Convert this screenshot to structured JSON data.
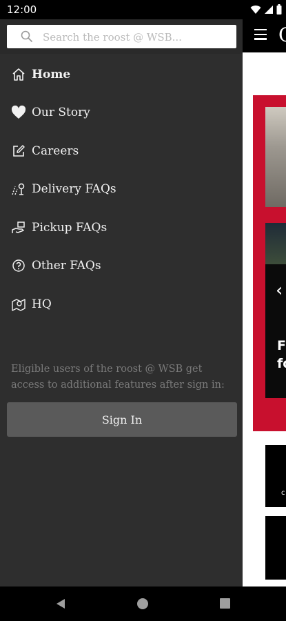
{
  "status_bar": {
    "time": "12:00",
    "icons": [
      "wifi-icon",
      "signal-icon",
      "battery-icon"
    ]
  },
  "search": {
    "placeholder": "Search the roost @ WSB..."
  },
  "menu": {
    "items": [
      {
        "label": "Home",
        "icon": "home-icon",
        "active": true
      },
      {
        "label": "Our Story",
        "icon": "heart-icon"
      },
      {
        "label": "Careers",
        "icon": "edit-icon"
      },
      {
        "label": "Delivery FAQs",
        "icon": "delivery-icon"
      },
      {
        "label": "Pickup FAQs",
        "icon": "pickup-icon"
      },
      {
        "label": "Other FAQs",
        "icon": "question-icon"
      },
      {
        "label": "HQ",
        "icon": "map-pin-icon"
      }
    ]
  },
  "signin": {
    "note": "Eligible users of the roost @ WSB get access to additional features after sign in:",
    "button_label": "Sign In"
  },
  "background_app": {
    "brand_fragment": "C",
    "card_text_fragment": "F\nfo",
    "card2_fragment": "c"
  },
  "colors": {
    "drawer_bg": "#2e2e2e",
    "accent_red": "#c8102e",
    "button_bg": "#5a5a5a"
  }
}
